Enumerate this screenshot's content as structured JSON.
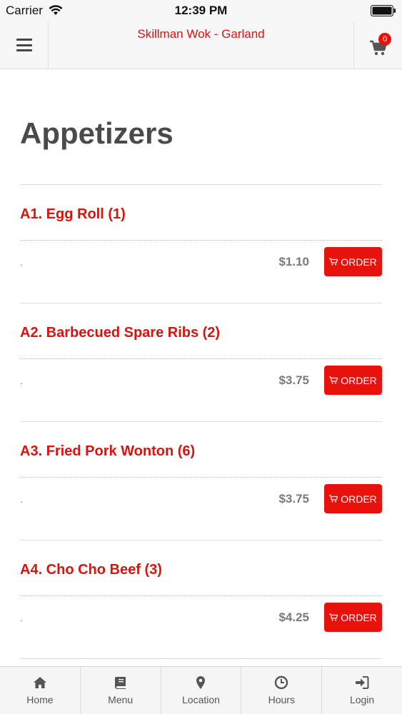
{
  "status_bar": {
    "carrier": "Carrier",
    "time": "12:39 PM"
  },
  "header": {
    "title": "Skillman Wok - Garland",
    "cart_count": "0"
  },
  "page": {
    "title": "Appetizers"
  },
  "items": [
    {
      "name": "A1. Egg Roll (1)",
      "description": ".",
      "price": "$1.10",
      "order_label": "ORDER"
    },
    {
      "name": "A2. Barbecued Spare Ribs (2)",
      "description": ".",
      "price": "$3.75",
      "order_label": "ORDER"
    },
    {
      "name": "A3. Fried Pork Wonton (6)",
      "description": ".",
      "price": "$3.75",
      "order_label": "ORDER"
    },
    {
      "name": "A4. Cho Cho Beef (3)",
      "description": ".",
      "price": "$4.25",
      "order_label": "ORDER"
    }
  ],
  "tabs": [
    {
      "label": "Home",
      "icon": "home-icon"
    },
    {
      "label": "Menu",
      "icon": "book-icon"
    },
    {
      "label": "Location",
      "icon": "map-pin-icon"
    },
    {
      "label": "Hours",
      "icon": "clock-icon"
    },
    {
      "label": "Login",
      "icon": "sign-in-icon"
    }
  ],
  "colors": {
    "accent": "#d8140f",
    "button": "#e8120c",
    "heading": "#4a4a4a",
    "price": "#7a7a7a"
  }
}
